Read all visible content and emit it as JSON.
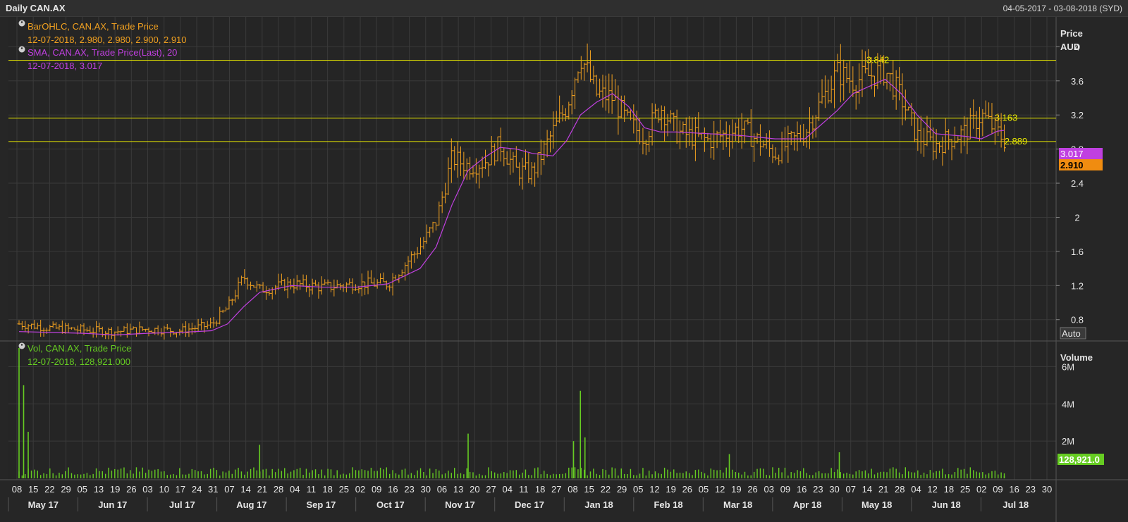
{
  "title": "Daily CAN.AX",
  "date_range": "04-05-2017 - 03-08-2018 (SYD)",
  "colors": {
    "background": "#262626",
    "grid": "#3a3a3a",
    "price": "#f0a020",
    "sma": "#c040e0",
    "volume": "#66cc22",
    "yellow_line": "#e8e800",
    "text": "#e6e6e6"
  },
  "price_panel": {
    "legend": [
      {
        "icon": "info-icon",
        "label": "BarOHLC, CAN.AX, Trade Price",
        "value": "12-07-2018, 2.980, 2.980, 2.900, 2.910",
        "color": "#f0a020"
      },
      {
        "icon": "info-icon",
        "label": "SMA, CAN.AX, Trade Price(Last),  20",
        "value": "12-07-2018, 3.017",
        "color": "#c040e0"
      }
    ],
    "axis_title_1": "Price",
    "axis_title_2": "AUD",
    "y_ticks": [
      "4",
      "3.6",
      "3.2",
      "2.8",
      "2.4",
      "2",
      "1.6",
      "1.2",
      "0.8"
    ],
    "auto_button": "Auto",
    "last_sma_badge": "3.017",
    "last_price_badge": "2.910",
    "levels": [
      {
        "value": 3.842,
        "label": "3.842"
      },
      {
        "value": 3.163,
        "label": "3.163"
      },
      {
        "value": 2.889,
        "label": "2.889"
      }
    ]
  },
  "volume_panel": {
    "legend": {
      "icon": "info-icon",
      "label": "Vol, CAN.AX, Trade Price",
      "value": "12-07-2018, 128,921.000",
      "color": "#66cc22"
    },
    "axis_title": "Volume",
    "y_ticks": [
      "6M",
      "4M",
      "2M"
    ],
    "last_volume_badge": "128,921.0"
  },
  "x_axis": {
    "days": [
      "08",
      "15",
      "22",
      "29",
      "05",
      "13",
      "19",
      "26",
      "03",
      "10",
      "17",
      "24",
      "31",
      "07",
      "14",
      "21",
      "28",
      "04",
      "11",
      "18",
      "25",
      "02",
      "09",
      "16",
      "23",
      "30",
      "06",
      "13",
      "20",
      "27",
      "04",
      "11",
      "18",
      "27",
      "08",
      "15",
      "22",
      "29",
      "05",
      "12",
      "19",
      "26",
      "05",
      "12",
      "19",
      "26",
      "03",
      "09",
      "16",
      "23",
      "30",
      "07",
      "14",
      "21",
      "28",
      "04",
      "12",
      "18",
      "25",
      "02",
      "09",
      "16",
      "23",
      "30"
    ],
    "months": [
      "May 17",
      "Jun 17",
      "Jul 17",
      "Aug 17",
      "Sep 17",
      "Oct 17",
      "Nov 17",
      "Dec 17",
      "Jan 18",
      "Feb 18",
      "Mar 18",
      "Apr 18",
      "May 18",
      "Jun 18",
      "Jul 18"
    ]
  },
  "chart_data": [
    {
      "type": "line",
      "title": "Daily CAN.AX",
      "ylabel": "Price AUD",
      "ylim": [
        0.55,
        4.35
      ],
      "x": [
        "2017-05-08",
        "2017-05-22",
        "2017-06-05",
        "2017-06-19",
        "2017-07-03",
        "2017-07-17",
        "2017-07-31",
        "2017-08-07",
        "2017-08-14",
        "2017-08-21",
        "2017-09-04",
        "2017-09-18",
        "2017-10-02",
        "2017-10-16",
        "2017-10-30",
        "2017-11-06",
        "2017-11-13",
        "2017-11-20",
        "2017-11-27",
        "2017-12-04",
        "2017-12-11",
        "2017-12-18",
        "2017-12-27",
        "2018-01-02",
        "2018-01-08",
        "2018-01-15",
        "2018-01-22",
        "2018-01-29",
        "2018-02-05",
        "2018-02-12",
        "2018-02-19",
        "2018-03-05",
        "2018-03-19",
        "2018-04-03",
        "2018-04-16",
        "2018-04-30",
        "2018-05-07",
        "2018-05-21",
        "2018-05-28",
        "2018-06-04",
        "2018-06-12",
        "2018-06-25",
        "2018-07-02",
        "2018-07-09",
        "2018-07-12"
      ],
      "series": [
        {
          "name": "BarOHLC, CAN.AX, Trade Price",
          "values": [
            0.75,
            0.7,
            0.68,
            0.66,
            0.69,
            0.67,
            0.74,
            0.94,
            1.3,
            1.15,
            1.22,
            1.18,
            1.22,
            1.22,
            1.65,
            1.95,
            2.7,
            2.6,
            2.65,
            2.85,
            2.55,
            2.52,
            3.0,
            3.3,
            3.9,
            3.45,
            3.4,
            3.1,
            2.95,
            3.3,
            3.0,
            2.9,
            3.05,
            2.75,
            3.0,
            3.7,
            3.6,
            3.72,
            3.4,
            2.95,
            2.85,
            3.0,
            3.2,
            3.0,
            2.91
          ]
        },
        {
          "name": "SMA, CAN.AX, Trade Price(Last),  20",
          "values": [
            0.66,
            0.65,
            0.64,
            0.62,
            0.64,
            0.65,
            0.67,
            0.75,
            0.95,
            1.12,
            1.2,
            1.18,
            1.18,
            1.22,
            1.4,
            1.65,
            2.15,
            2.55,
            2.7,
            2.82,
            2.8,
            2.75,
            2.72,
            2.9,
            3.2,
            3.35,
            3.45,
            3.3,
            3.05,
            3.0,
            3.0,
            2.98,
            2.96,
            2.92,
            2.92,
            3.25,
            3.45,
            3.62,
            3.45,
            3.2,
            2.98,
            2.95,
            2.92,
            3.01,
            3.02
          ]
        }
      ]
    },
    {
      "type": "bar",
      "ylabel": "Volume",
      "ylim": [
        0,
        7000000
      ],
      "categories": [
        "2017-05-08",
        "2017-05-10",
        "2017-05-12",
        "2017-08-21",
        "2017-11-20",
        "2018-01-05",
        "2018-01-08",
        "2018-01-10",
        "2018-03-14",
        "2018-05-01",
        "2018-07-12"
      ],
      "values": [
        7000000,
        5000000,
        2500000,
        1800000,
        2400000,
        2000000,
        4700000,
        2200000,
        1300000,
        1400000,
        128921
      ]
    }
  ]
}
